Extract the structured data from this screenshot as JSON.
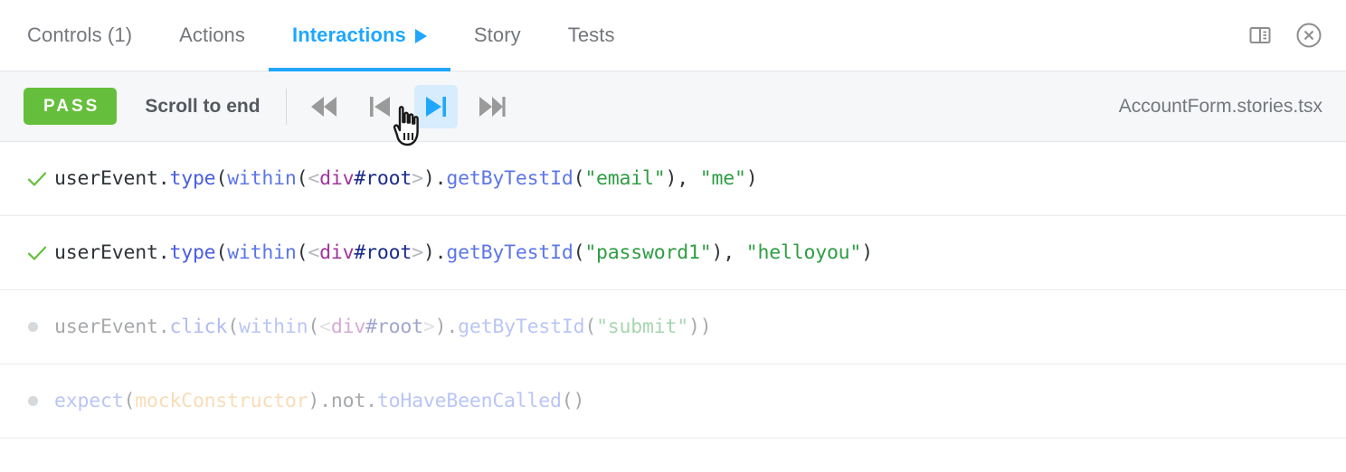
{
  "tabs": [
    {
      "label": "Controls (1)",
      "active": false,
      "has_play_icon": false
    },
    {
      "label": "Actions",
      "active": false,
      "has_play_icon": false
    },
    {
      "label": "Interactions",
      "active": true,
      "has_play_icon": true
    },
    {
      "label": "Story",
      "active": false,
      "has_play_icon": false
    },
    {
      "label": "Tests",
      "active": false,
      "has_play_icon": false
    }
  ],
  "tabbar_right": {
    "layout_icon": "sidebar-layout-icon",
    "close_icon": "close-circle-icon"
  },
  "toolbar": {
    "status_label": "PASS",
    "status_color": "#66bf3c",
    "scroll_label": "Scroll to end",
    "filename": "AccountForm.stories.tsx",
    "controls": [
      {
        "name": "rewind-button",
        "icon": "rewind-icon",
        "selected": false
      },
      {
        "name": "step-back-button",
        "icon": "step-back-icon",
        "selected": false
      },
      {
        "name": "step-forward-button",
        "icon": "step-forward-icon",
        "selected": true
      },
      {
        "name": "fast-forward-button",
        "icon": "fast-forward-icon",
        "selected": false
      }
    ],
    "cursor": "pointing-hand-cursor",
    "accent_color": "#1ea7fd",
    "highlight_color": "#d7ecfd"
  },
  "interactions": [
    {
      "status": "pass",
      "marker": "check-icon",
      "text": "userEvent.type(within(<div#root>).getByTestId(\"email\"), \"me\")",
      "tokens": [
        {
          "t": "userEvent",
          "c": "plain"
        },
        {
          "t": ".",
          "c": "punct"
        },
        {
          "t": "type",
          "c": "fn"
        },
        {
          "t": "(",
          "c": "punct"
        },
        {
          "t": "within",
          "c": "method"
        },
        {
          "t": "(",
          "c": "punct"
        },
        {
          "t": "<",
          "c": "angle"
        },
        {
          "t": "div",
          "c": "tag"
        },
        {
          "t": "#root",
          "c": "id"
        },
        {
          "t": ">",
          "c": "angle"
        },
        {
          "t": ")",
          "c": "punct"
        },
        {
          "t": ".",
          "c": "punct"
        },
        {
          "t": "getByTestId",
          "c": "method"
        },
        {
          "t": "(",
          "c": "punct"
        },
        {
          "t": "\"email\"",
          "c": "string"
        },
        {
          "t": "), ",
          "c": "punct"
        },
        {
          "t": "\"me\"",
          "c": "string"
        },
        {
          "t": ")",
          "c": "punct"
        }
      ]
    },
    {
      "status": "pass",
      "marker": "check-icon",
      "text": "userEvent.type(within(<div#root>).getByTestId(\"password1\"), \"helloyou\")",
      "tokens": [
        {
          "t": "userEvent",
          "c": "plain"
        },
        {
          "t": ".",
          "c": "punct"
        },
        {
          "t": "type",
          "c": "fn"
        },
        {
          "t": "(",
          "c": "punct"
        },
        {
          "t": "within",
          "c": "method"
        },
        {
          "t": "(",
          "c": "punct"
        },
        {
          "t": "<",
          "c": "angle"
        },
        {
          "t": "div",
          "c": "tag"
        },
        {
          "t": "#root",
          "c": "id"
        },
        {
          "t": ">",
          "c": "angle"
        },
        {
          "t": ")",
          "c": "punct"
        },
        {
          "t": ".",
          "c": "punct"
        },
        {
          "t": "getByTestId",
          "c": "method"
        },
        {
          "t": "(",
          "c": "punct"
        },
        {
          "t": "\"password1\"",
          "c": "string"
        },
        {
          "t": "), ",
          "c": "punct"
        },
        {
          "t": "\"helloyou\"",
          "c": "string"
        },
        {
          "t": ")",
          "c": "punct"
        }
      ]
    },
    {
      "status": "pending",
      "marker": "dot-icon",
      "text": "userEvent.click(within(<div#root>).getByTestId(\"submit\"))",
      "tokens": [
        {
          "t": "userEvent",
          "c": "plain"
        },
        {
          "t": ".",
          "c": "punct"
        },
        {
          "t": "click",
          "c": "fn"
        },
        {
          "t": "(",
          "c": "punct"
        },
        {
          "t": "within",
          "c": "method"
        },
        {
          "t": "(",
          "c": "punct"
        },
        {
          "t": "<",
          "c": "angle"
        },
        {
          "t": "div",
          "c": "tag"
        },
        {
          "t": "#root",
          "c": "id"
        },
        {
          "t": ">",
          "c": "angle"
        },
        {
          "t": ")",
          "c": "punct"
        },
        {
          "t": ".",
          "c": "punct"
        },
        {
          "t": "getByTestId",
          "c": "method"
        },
        {
          "t": "(",
          "c": "punct"
        },
        {
          "t": "\"submit\"",
          "c": "string"
        },
        {
          "t": "))",
          "c": "punct"
        }
      ]
    },
    {
      "status": "pending",
      "marker": "dot-icon",
      "text": "expect(mockConstructor).not.toHaveBeenCalled()",
      "tokens": [
        {
          "t": "expect",
          "c": "method"
        },
        {
          "t": "(",
          "c": "punct"
        },
        {
          "t": "mockConstructor",
          "c": "var"
        },
        {
          "t": ")",
          "c": "punct"
        },
        {
          "t": ".",
          "c": "punct"
        },
        {
          "t": "not",
          "c": "plain"
        },
        {
          "t": ".",
          "c": "punct"
        },
        {
          "t": "toHaveBeenCalled",
          "c": "method"
        },
        {
          "t": "()",
          "c": "punct"
        }
      ]
    }
  ]
}
